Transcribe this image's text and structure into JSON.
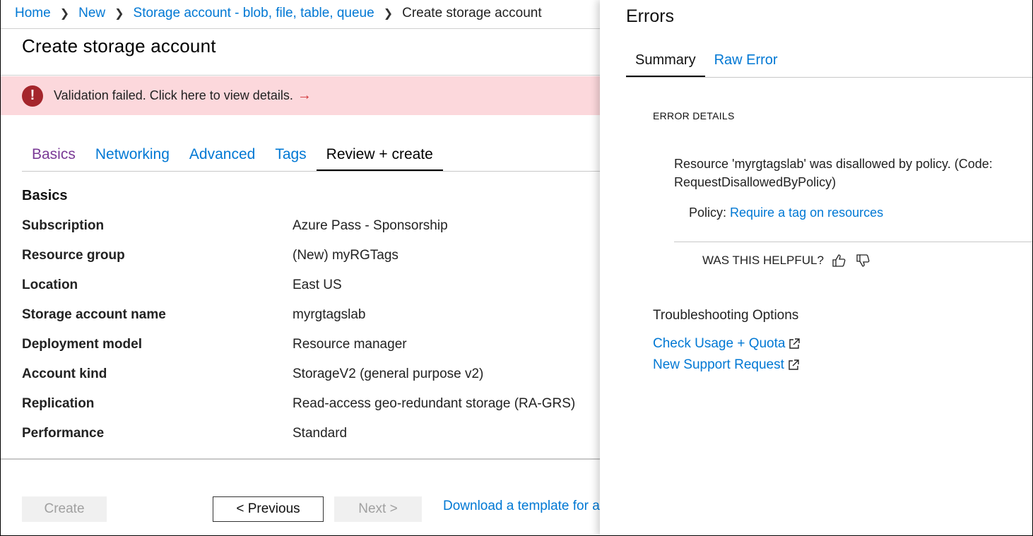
{
  "breadcrumb": {
    "items": [
      "Home",
      "New",
      "Storage account - blob, file, table, queue"
    ],
    "current": "Create storage account",
    "separator": ">"
  },
  "page": {
    "title": "Create storage account"
  },
  "banner": {
    "text": "Validation failed. Click here to view details.",
    "arrow": "→",
    "icon": "error-icon",
    "bg_color": "#fcd8dc",
    "icon_color": "#a4262c"
  },
  "tabs": [
    "Basics",
    "Networking",
    "Advanced",
    "Tags",
    "Review + create"
  ],
  "active_tab": "Review + create",
  "summary": {
    "section_title": "Basics",
    "rows": [
      {
        "label": "Subscription",
        "value": "Azure Pass - Sponsorship"
      },
      {
        "label": "Resource group",
        "value": "(New) myRGTags"
      },
      {
        "label": "Location",
        "value": "East US"
      },
      {
        "label": "Storage account name",
        "value": "myrgtagslab"
      },
      {
        "label": "Deployment model",
        "value": "Resource manager"
      },
      {
        "label": "Account kind",
        "value": "StorageV2 (general purpose v2)"
      },
      {
        "label": "Replication",
        "value": "Read-access geo-redundant storage (RA-GRS)"
      },
      {
        "label": "Performance",
        "value": "Standard"
      }
    ]
  },
  "footer": {
    "create_label": "Create",
    "previous_label": "< Previous",
    "next_label": "Next >",
    "download_label": "Download a template for automation"
  },
  "errors_panel": {
    "title": "Errors",
    "tabs": [
      "Summary",
      "Raw Error"
    ],
    "active_tab": "Summary",
    "details_label": "ERROR DETAILS",
    "message": "Resource 'myrgtagslab' was disallowed by policy. (Code: RequestDisallowedByPolicy)",
    "policy_prefix": "Policy:",
    "policy_link": "Require a tag on resources",
    "helpful_label": "WAS THIS HELPFUL?",
    "troubleshooting_title": "Troubleshooting Options",
    "links": [
      "Check Usage + Quota",
      "New Support Request"
    ]
  },
  "colors": {
    "link": "#0078d4",
    "visited": "#7a3a96"
  }
}
